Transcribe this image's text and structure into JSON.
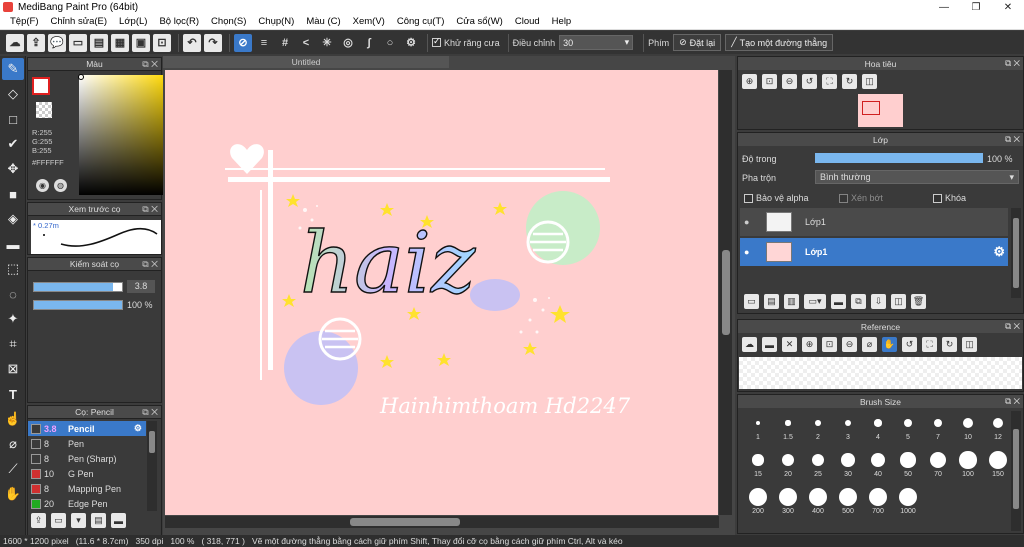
{
  "window": {
    "title": "MediBang Paint Pro (64bit)"
  },
  "menu": [
    "Tệp(F)",
    "Chỉnh sửa(E)",
    "Lớp(L)",
    "Bộ lọc(R)",
    "Chọn(S)",
    "Chụp(N)",
    "Màu (C)",
    "Xem(V)",
    "Công cụ(T)",
    "Cửa sổ(W)",
    "Cloud",
    "Help"
  ],
  "toolbar": {
    "antialias_label": "Khử răng cưa",
    "adjust_label": "Điều chỉnh",
    "adjust_value": "30",
    "pen_label": "Phím",
    "reset_label": "Đặt lại",
    "line_label": "Tạo một đường thẳng"
  },
  "color_panel": {
    "title": "Màu",
    "r": "R:255",
    "g": "G:255",
    "b": "B:255",
    "hex": "#FFFFFF"
  },
  "preview_panel": {
    "title": "Xem trước cọ",
    "size": "0.27m"
  },
  "control_panel": {
    "title": "Kiểm soát cọ",
    "size_value": "3.8",
    "size_fraction": 0.9,
    "opacity_value": "100 %",
    "opacity_fraction": 1.0
  },
  "brush_panel": {
    "title": "Cọ: Pencil",
    "items": [
      {
        "size": "3.8",
        "name": "Pencil",
        "color": "#3a3a3a",
        "selected": true
      },
      {
        "size": "8",
        "name": "Pen",
        "color": "#3a3a3a",
        "selected": false
      },
      {
        "size": "8",
        "name": "Pen (Sharp)",
        "color": "#3a3a3a",
        "selected": false
      },
      {
        "size": "10",
        "name": "G Pen",
        "color": "#d03030",
        "selected": false
      },
      {
        "size": "8",
        "name": "Mapping Pen",
        "color": "#d03030",
        "selected": false
      },
      {
        "size": "20",
        "name": "Edge Pen",
        "color": "#22aa22",
        "selected": false
      }
    ]
  },
  "canvas": {
    "tab": "Untitled",
    "signature": "Hainhimthoam Hd2247",
    "lettering": "haiz"
  },
  "navigator": {
    "title": "Hoa tiêu"
  },
  "layers": {
    "title": "Lớp",
    "opacity_label": "Độ trong",
    "opacity_value": "100 %",
    "opacity_fraction": 1.0,
    "blend_label": "Pha trộn",
    "blend_value": "Bình thường",
    "protect_alpha": "Bảo vệ alpha",
    "clipping": "Xén bớt",
    "lock": "Khóa",
    "list": [
      {
        "name": "Lớp1",
        "selected": false,
        "thumb": "#f3f3f3"
      },
      {
        "name": "Lớp1",
        "selected": true,
        "thumb": "#ffd6d6"
      }
    ]
  },
  "reference": {
    "title": "Reference"
  },
  "brush_size": {
    "title": "Brush Size",
    "sizes": [
      "1",
      "1.5",
      "2",
      "3",
      "4",
      "5",
      "7",
      "10",
      "12",
      "15",
      "20",
      "25",
      "30",
      "40",
      "50",
      "70",
      "100",
      "150",
      "200",
      "300",
      "400",
      "500",
      "700",
      "1000"
    ]
  },
  "status": {
    "dims": "1600 * 1200 pixel",
    "physical": "(11.6 * 8.7cm)",
    "dpi": "350 dpi",
    "zoom": "100 %",
    "cursor": "( 318, 771 )",
    "hint": "Vẽ một đường thẳng bằng cách giữ phím Shift, Thay đổi cỡ cọ bằng cách giữ phím Ctrl, Alt và kéo"
  }
}
